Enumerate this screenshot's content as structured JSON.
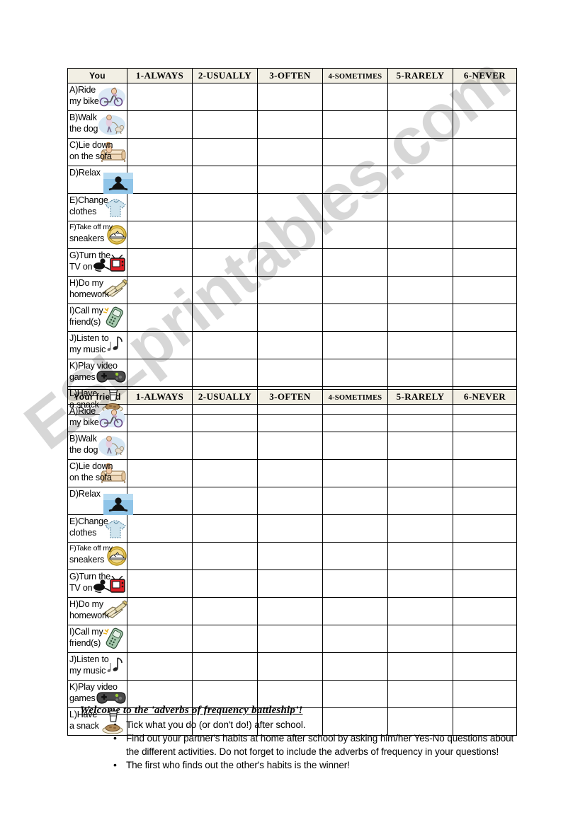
{
  "watermark": {
    "text": "ESLprintables.com"
  },
  "columns": [
    {
      "key": "always",
      "label": "1-ALWAYS",
      "small": false
    },
    {
      "key": "usually",
      "label": "2-USUALLY",
      "small": false
    },
    {
      "key": "often",
      "label": "3-OFTEN",
      "small": false
    },
    {
      "key": "sometimes",
      "label": "4-SOMETIMES",
      "small": true
    },
    {
      "key": "rarely",
      "label": "5-RARELY",
      "small": false
    },
    {
      "key": "never",
      "label": "6-NEVER",
      "small": false
    }
  ],
  "activities": [
    {
      "line1": "A)Ride",
      "line2": "my bike",
      "icon": "bicycle-icon",
      "tiny": false
    },
    {
      "line1": "B)Walk",
      "line2": "the dog",
      "icon": "dog-walking-icon",
      "tiny": false
    },
    {
      "line1": "C)Lie down",
      "line2": "on the sofa",
      "icon": "sofa-icon",
      "tiny": false
    },
    {
      "line1": "D)Relax",
      "line2": "",
      "icon": "meditation-icon",
      "tiny": false
    },
    {
      "line1": "E)Change",
      "line2": "clothes",
      "icon": "clothes-icon",
      "tiny": false
    },
    {
      "line1": "F)Take off my",
      "line2": "sneakers",
      "icon": "sneaker-icon",
      "tiny": true
    },
    {
      "line1": "G)Turn the",
      "line2": "TV on",
      "icon": "television-icon",
      "tiny": false
    },
    {
      "line1": "H)Do my",
      "line2": "homework",
      "icon": "homework-icon",
      "tiny": false
    },
    {
      "line1": "I)Call my",
      "line2": "friend(s)",
      "icon": "mobile-phone-icon",
      "tiny": false
    },
    {
      "line1": "J)Listen to",
      "line2": "my music",
      "icon": "music-note-icon",
      "tiny": false
    },
    {
      "line1": "K)Play video",
      "line2": "games",
      "icon": "gamepad-icon",
      "tiny": false
    },
    {
      "line1": "L)Have",
      "line2": "a snack",
      "icon": "snack-icon",
      "tiny": false
    }
  ],
  "tables": [
    {
      "id": "you",
      "row_header": "You"
    },
    {
      "id": "friend",
      "row_header": "Your friend"
    }
  ],
  "instructions": {
    "title": "Welcome to the 'adverbs of frequency battleship'!",
    "bullet": "•",
    "items": [
      "Tick what you do (or don't do!) after school.",
      "Find out your partner's habits at home after school by asking him/her Yes-No questions about the different activities. Do not forget to include the adverbs of frequency in your questions!",
      "The first who finds out the other's habits is the winner!"
    ]
  },
  "colors": {
    "header_background": "#f2efe4",
    "border": "#000000",
    "page_background": "#ffffff",
    "watermark": "rgba(0,0,0,0.155)"
  }
}
